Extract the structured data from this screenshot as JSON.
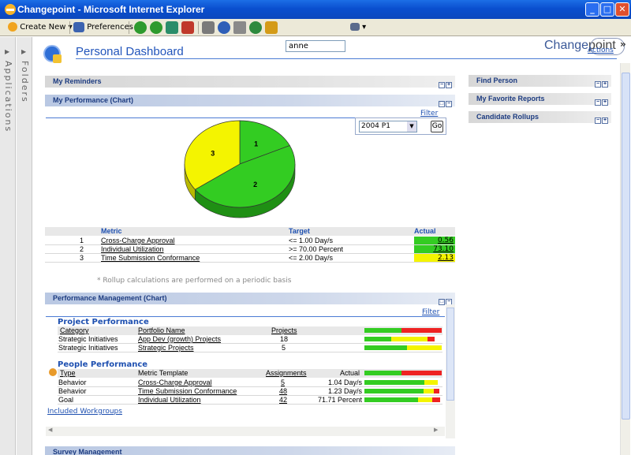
{
  "window": {
    "title": "Changepoint - Microsoft Internet Explorer"
  },
  "toolbar": {
    "create_new": "Create New",
    "preferences": "Preferences",
    "user_value": "anne",
    "brand_prefix": "Change",
    "brand_suffix": "point",
    "overflow": "»"
  },
  "leftbar": {
    "folders": "Folders",
    "applications": "Applications"
  },
  "page": {
    "title": "Personal Dashboard",
    "actions": "Actions"
  },
  "panels": {
    "reminders": "My Reminders",
    "performance": "My Performance (Chart)",
    "perf_mgmt": "Performance Management (Chart)",
    "survey": "Survey Management",
    "find_person": "Find Person",
    "favorite_reports": "My Favorite Reports",
    "candidate_rollups": "Candidate Rollups"
  },
  "performance": {
    "filter": "Filter",
    "period": "2004 P1",
    "go": "Go",
    "headers": {
      "metric": "Metric",
      "target": "Target",
      "actual": "Actual"
    },
    "rows": [
      {
        "num": "1",
        "metric": "Cross-Charge Approval",
        "target": "<= 1.00 Day/s",
        "actual": "0.56",
        "color": "#33cc22"
      },
      {
        "num": "2",
        "metric": "Individual Utilization",
        "target": ">= 70.00 Percent",
        "actual": "73.10",
        "color": "#33cc22"
      },
      {
        "num": "3",
        "metric": "Time Submission Conformance",
        "target": "<= 2.00 Day/s",
        "actual": "2.13",
        "color": "#f4f400"
      }
    ],
    "note": "* Rollup calculations are performed on a periodic basis"
  },
  "chart_data": {
    "type": "pie",
    "categories": [
      "1",
      "2",
      "3"
    ],
    "values": [
      18,
      47,
      35
    ],
    "colors": [
      "#33cc22",
      "#33cc22",
      "#f4f400"
    ]
  },
  "perf_mgmt": {
    "filter": "Filter",
    "project": {
      "title": "Project Performance",
      "headers": {
        "category": "Category",
        "portfolio": "Portfolio Name",
        "projects": "Projects"
      },
      "rows": [
        {
          "category": "Strategic Initiatives",
          "portfolio": "App Dev (growth) Projects",
          "projects": "18",
          "bar": [
            0.35,
            0.47,
            0.09
          ]
        },
        {
          "category": "Strategic Initiatives",
          "portfolio": "Strategic Projects",
          "projects": "5",
          "bar": [
            0.55,
            0.45,
            0
          ]
        }
      ],
      "header_bar": [
        0.48,
        0.52
      ]
    },
    "people": {
      "title": "People Performance",
      "headers": {
        "type": "Type",
        "template": "Metric Template",
        "assignments": "Assignments",
        "actual": "Actual"
      },
      "rows": [
        {
          "type": "Behavior",
          "template": "Cross-Charge Approval",
          "assignments": "5",
          "actual": "1.04 Day/s",
          "bar": [
            0.78,
            0.17,
            0.0
          ]
        },
        {
          "type": "Behavior",
          "template": "Time Submission Conformance",
          "assignments": "48",
          "actual": "1.23 Day/s",
          "bar": [
            0.77,
            0.13,
            0.07
          ]
        },
        {
          "type": "Goal",
          "template": "Individual Utilization",
          "assignments": "42",
          "actual": "71.71 Percent",
          "bar": [
            0.69,
            0.18,
            0.1
          ]
        }
      ],
      "header_bar": [
        0.48,
        0.52
      ]
    },
    "included_workgroups": "Included Workgroups"
  }
}
